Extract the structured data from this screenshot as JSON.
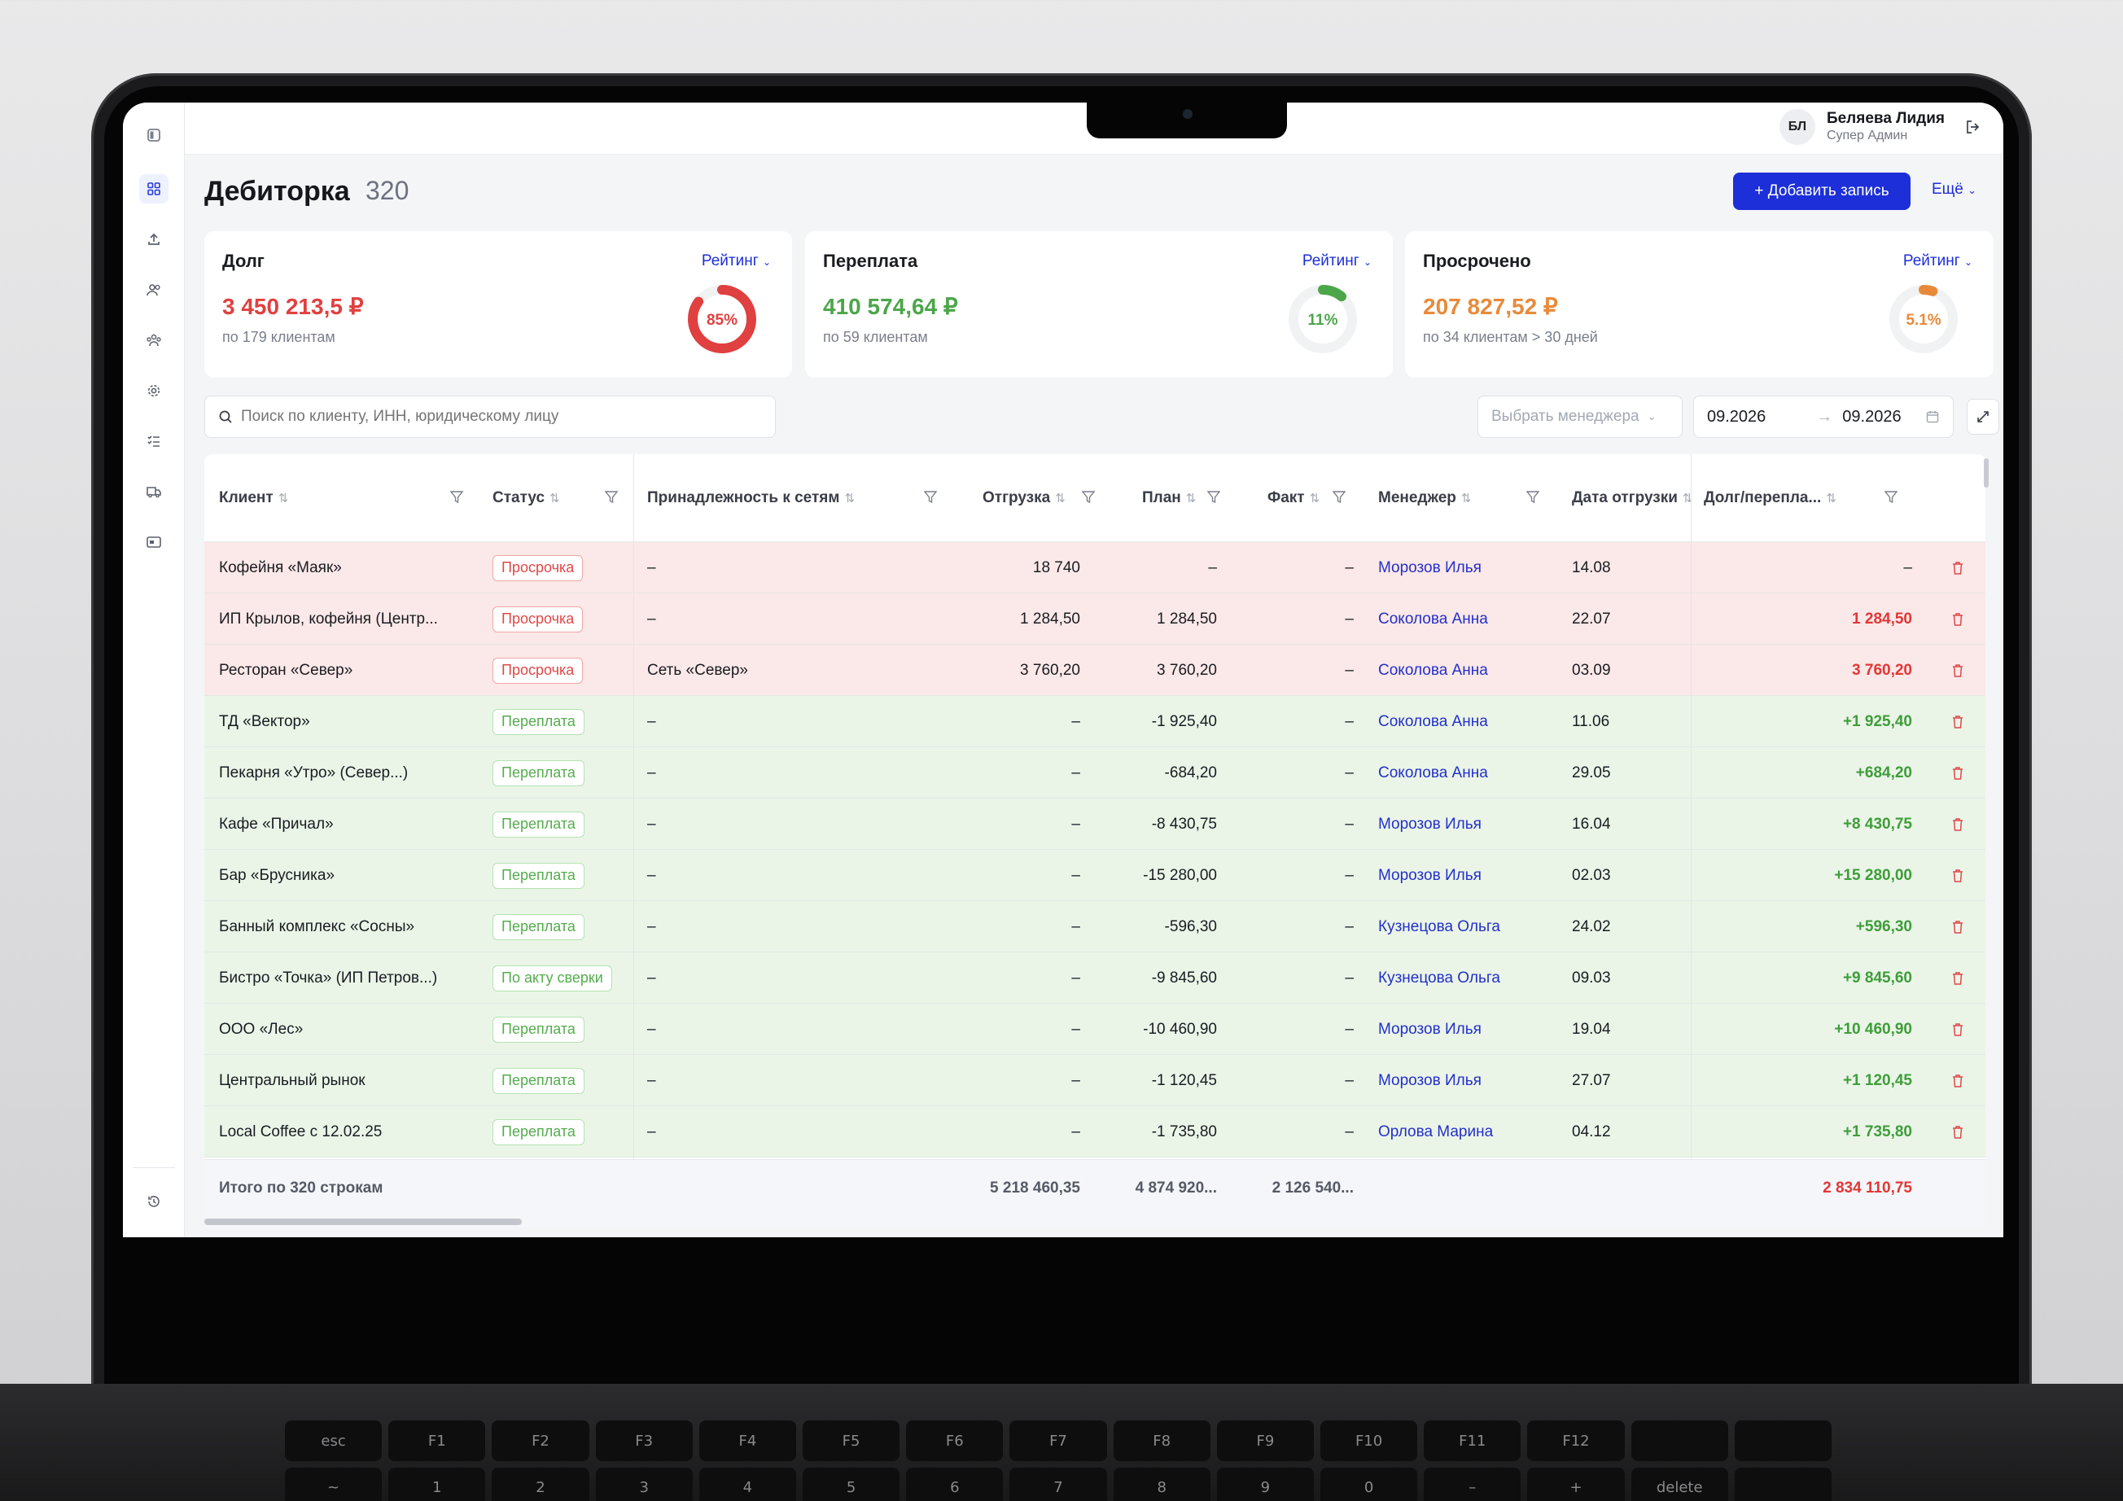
{
  "user": {
    "initials": "БЛ",
    "name": "Беляева Лидия",
    "role": "Супер Админ"
  },
  "page": {
    "title": "Дебиторка",
    "count": "320"
  },
  "actions": {
    "add_label": "+ Добавить запись",
    "more_label": "Ещё"
  },
  "cards": [
    {
      "title": "Долг",
      "rating": "Рейтинг",
      "value": "3 450 213,5 ₽",
      "sub": "по 179 клиентам",
      "percent": "85%",
      "percent_value": 85,
      "color": "#e04040"
    },
    {
      "title": "Переплата",
      "rating": "Рейтинг",
      "value": "410 574,64 ₽",
      "sub": "по 59 клиентам",
      "percent": "11%",
      "percent_value": 11,
      "color": "#4ca64a"
    },
    {
      "title": "Просрочено",
      "rating": "Рейтинг",
      "value": "207 827,52 ₽",
      "sub": "по 34 клиентам > 30 дней",
      "percent": "5.1%",
      "percent_value": 5.1,
      "color": "#e88a3a"
    }
  ],
  "filters": {
    "search_placeholder": "Поиск по клиенту, ИНН, юридическому лицу",
    "manager_placeholder": "Выбрать менеджера",
    "date_from": "09.2026",
    "date_arrow": "→",
    "date_to": "09.2026"
  },
  "columns": {
    "client": "Клиент",
    "status": "Статус",
    "network": "Принадлежность к сетям",
    "shipment": "Отгрузка",
    "plan": "План",
    "fact": "Факт",
    "manager": "Менеджер",
    "ship_date": "Дата отгрузки",
    "debt": "Долг/перепла..."
  },
  "rows": [
    {
      "client": "Кофейня «Маяк»",
      "status": "Просрочка",
      "tone": "red",
      "network": "–",
      "shipment": "18 740",
      "plan": "–",
      "fact": "–",
      "manager": "Морозов Илья",
      "date": "14.08",
      "debt": "–"
    },
    {
      "client": "ИП Крылов, кофейня (Центр...",
      "status": "Просрочка",
      "tone": "red",
      "network": "–",
      "shipment": "1 284,50",
      "plan": "1 284,50",
      "fact": "–",
      "manager": "Соколова Анна",
      "date": "22.07",
      "debt": "1 284,50"
    },
    {
      "client": "Ресторан «Север»",
      "status": "Просрочка",
      "tone": "red",
      "network": "Сеть «Север»",
      "shipment": "3 760,20",
      "plan": "3 760,20",
      "fact": "–",
      "manager": "Соколова Анна",
      "date": "03.09",
      "debt": "3 760,20"
    },
    {
      "client": "ТД «Вектор»",
      "status": "Переплата",
      "tone": "green",
      "network": "–",
      "shipment": "–",
      "plan": "-1 925,40",
      "fact": "–",
      "manager": "Соколова Анна",
      "date": "11.06",
      "debt": "+1 925,40"
    },
    {
      "client": "Пекарня «Утро» (Север...)",
      "status": "Переплата",
      "tone": "green",
      "network": "–",
      "shipment": "–",
      "plan": "-684,20",
      "fact": "–",
      "manager": "Соколова Анна",
      "date": "29.05",
      "debt": "+684,20"
    },
    {
      "client": "Кафе «Причал»",
      "status": "Переплата",
      "tone": "green",
      "network": "–",
      "shipment": "–",
      "plan": "-8 430,75",
      "fact": "–",
      "manager": "Морозов Илья",
      "date": "16.04",
      "debt": "+8 430,75"
    },
    {
      "client": "Бар «Брусника»",
      "status": "Переплата",
      "tone": "green",
      "network": "–",
      "shipment": "–",
      "plan": "-15 280,00",
      "fact": "–",
      "manager": "Морозов Илья",
      "date": "02.03",
      "debt": "+15 280,00"
    },
    {
      "client": "Банный комплекс «Сосны»",
      "status": "Переплата",
      "tone": "green",
      "network": "–",
      "shipment": "–",
      "plan": "-596,30",
      "fact": "–",
      "manager": "Кузнецова Ольга",
      "date": "24.02",
      "debt": "+596,30"
    },
    {
      "client": "Бистро «Точка» (ИП Петров...)",
      "status": "По акту сверки",
      "tone": "green",
      "network": "–",
      "shipment": "–",
      "plan": "-9 845,60",
      "fact": "–",
      "manager": "Кузнецова Ольга",
      "date": "09.03",
      "debt": "+9 845,60"
    },
    {
      "client": "ООО «Лес»",
      "status": "Переплата",
      "tone": "green",
      "network": "–",
      "shipment": "–",
      "plan": "-10 460,90",
      "fact": "–",
      "manager": "Морозов Илья",
      "date": "19.04",
      "debt": "+10 460,90"
    },
    {
      "client": "Центральный рынок",
      "status": "Переплата",
      "tone": "green",
      "network": "–",
      "shipment": "–",
      "plan": "-1 120,45",
      "fact": "–",
      "manager": "Морозов Илья",
      "date": "27.07",
      "debt": "+1 120,45"
    },
    {
      "client": "Local Coffee c 12.02.25",
      "status": "Переплата",
      "tone": "green",
      "network": "–",
      "shipment": "–",
      "plan": "-1 735,80",
      "fact": "–",
      "manager": "Орлова Марина",
      "date": "04.12",
      "debt": "+1 735,80"
    }
  ],
  "totals": {
    "label": "Итого по 320 строкам",
    "shipment": "5 218 460,35",
    "plan": "4 874 920...",
    "fact": "2 126 540...",
    "debt": "2 834 110,75"
  },
  "keyboard": [
    "esc",
    "F1",
    "F2",
    "F3",
    "F4",
    "F5",
    "F6",
    "F7",
    "F8",
    "F9",
    "F10",
    "F11",
    "F12",
    "",
    "",
    "~",
    "1",
    "2",
    "3",
    "4",
    "5",
    "6",
    "7",
    "8",
    "9",
    "0",
    "–",
    "+",
    "delete",
    ""
  ]
}
